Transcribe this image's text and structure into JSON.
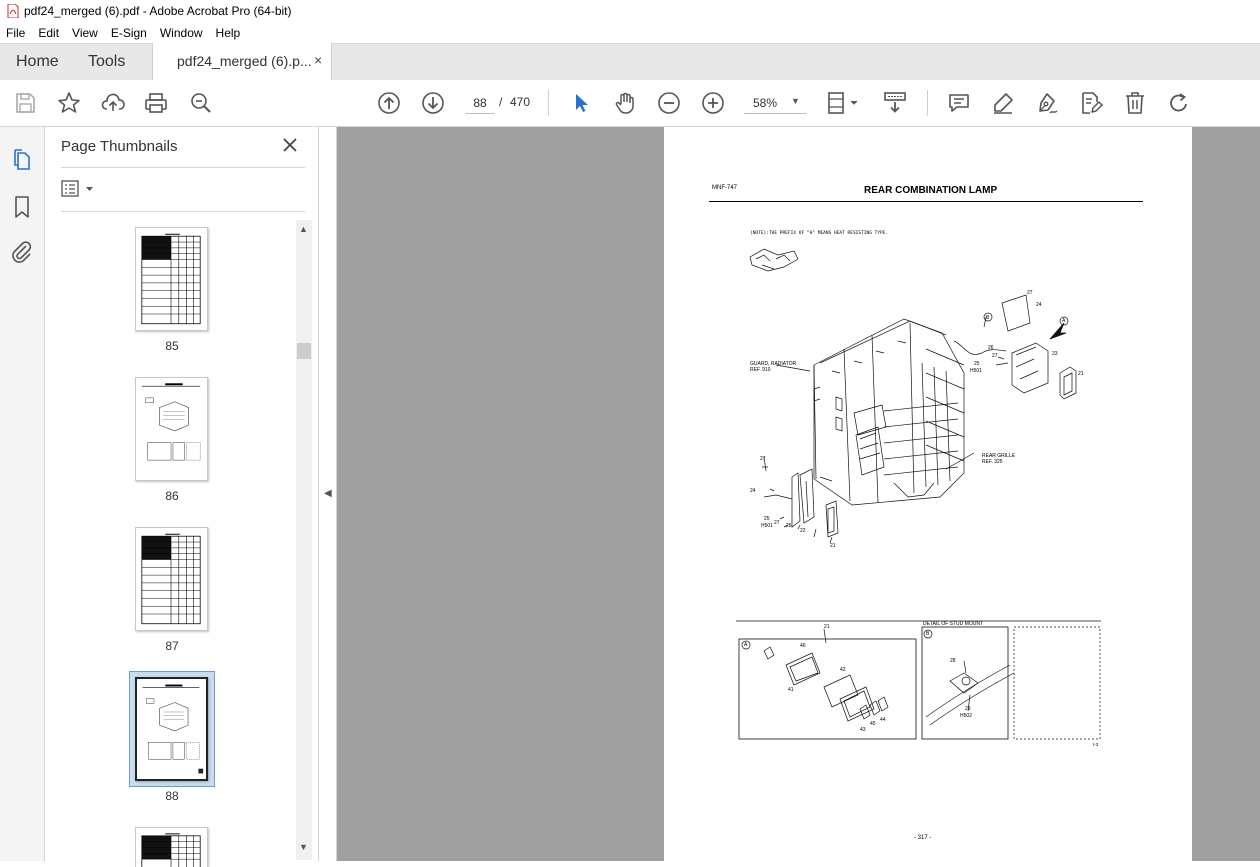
{
  "window": {
    "title": "pdf24_merged (6).pdf - Adobe Acrobat Pro (64-bit)"
  },
  "menu": [
    "File",
    "Edit",
    "View",
    "E-Sign",
    "Window",
    "Help"
  ],
  "tabs": {
    "home": "Home",
    "tools": "Tools",
    "document": "pdf24_merged (6).p...",
    "close_glyph": "×"
  },
  "toolbar": {
    "page_current": "88",
    "page_separator": "/",
    "page_total": "470",
    "zoom": "58%",
    "icons": [
      "save-icon",
      "star-icon",
      "upload-icon",
      "print-icon",
      "zoom-search-icon",
      "page-up-icon",
      "page-down-icon",
      "select-cursor-icon",
      "hand-icon",
      "zoom-out-icon",
      "zoom-in-icon",
      "fit-page-icon",
      "scroll-mode-icon",
      "comment-icon",
      "highlight-icon",
      "sign-icon",
      "edit-pdf-icon",
      "delete-icon",
      "rotate-icon"
    ]
  },
  "rail": {
    "icons": [
      "page-thumbnails-icon",
      "bookmark-icon",
      "attachment-icon"
    ]
  },
  "thumbnails": {
    "heading": "Page Thumbnails",
    "pages": [
      {
        "label": "85",
        "kind": "table"
      },
      {
        "label": "86",
        "kind": "drawing"
      },
      {
        "label": "87",
        "kind": "table"
      },
      {
        "label": "88",
        "kind": "drawing",
        "selected": true
      },
      {
        "label": "",
        "kind": "table"
      }
    ]
  },
  "document_page": {
    "header_code": "MNF-747",
    "title": "REAR COMBINATION LAMP",
    "note": "(NOTE):THE PREFIX OF \"H\" MEANS HEAT RESISTING TYPE.",
    "callouts": {
      "guard": "GUARD, RADIATOR",
      "guard_ref": "REF. 910",
      "grille": "REAR GRILLE",
      "grille_ref": "REF. 325",
      "detail": "DETAIL OF STUD MOUNT",
      "n21": "21",
      "n22": "22",
      "n23": "23",
      "n24": "24",
      "n25": "25",
      "n26": "26",
      "n27": "27",
      "n28": "28",
      "n29": "29",
      "n41": "41",
      "n42": "42",
      "n43": "43",
      "n44": "44",
      "n45": "45",
      "n46": "46",
      "h501": "H501",
      "h502": "H502",
      "a": "A",
      "b": "B"
    },
    "footer_number": "- 317 -",
    "corner_mark": "t-3"
  },
  "colors": {
    "accent": "#2d6fd0",
    "viewer_bg": "#a0a0a0",
    "selection": "#c9dcf0"
  }
}
